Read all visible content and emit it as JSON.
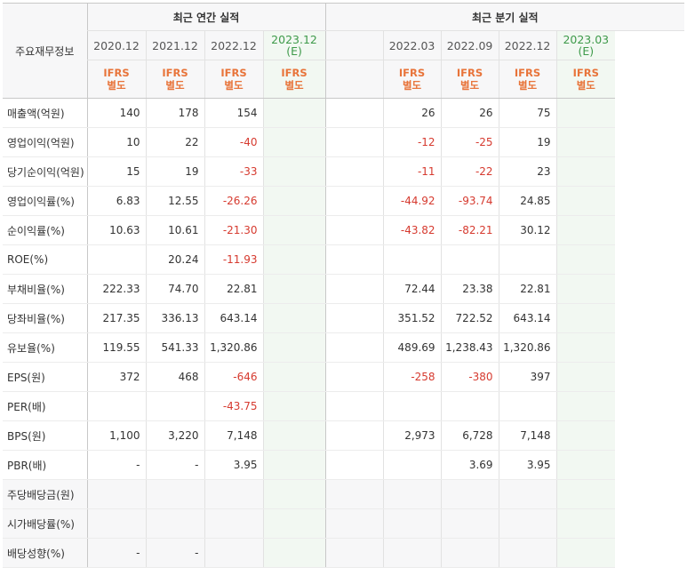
{
  "header": {
    "corner_label": "주요재무정보",
    "group_annual": "최근 연간 실적",
    "group_quarterly": "최근 분기 실적",
    "annual_columns": [
      {
        "period": "2020.12",
        "estimate": "",
        "basis_1": "IFRS",
        "basis_2": "별도"
      },
      {
        "period": "2021.12",
        "estimate": "",
        "basis_1": "IFRS",
        "basis_2": "별도"
      },
      {
        "period": "2022.12",
        "estimate": "",
        "basis_1": "IFRS",
        "basis_2": "별도"
      },
      {
        "period": "2023.12",
        "estimate": "(E)",
        "basis_1": "IFRS",
        "basis_2": "별도"
      }
    ],
    "quarter_columns": [
      {
        "period": "",
        "estimate": "",
        "basis_1": "",
        "basis_2": ""
      },
      {
        "period": "2022.03",
        "estimate": "",
        "basis_1": "IFRS",
        "basis_2": "별도"
      },
      {
        "period": "2022.09",
        "estimate": "",
        "basis_1": "IFRS",
        "basis_2": "별도"
      },
      {
        "period": "2022.12",
        "estimate": "",
        "basis_1": "IFRS",
        "basis_2": "별도"
      },
      {
        "period": "2023.03",
        "estimate": "(E)",
        "basis_1": "IFRS",
        "basis_2": "별도"
      }
    ]
  },
  "rows": [
    {
      "label": "매출액(억원)",
      "annual": [
        "140",
        "178",
        "154",
        ""
      ],
      "quarterly": [
        "",
        "",
        "26",
        "26",
        "75",
        ""
      ]
    },
    {
      "label": "영업이익(억원)",
      "annual": [
        "10",
        "22",
        "-40",
        ""
      ],
      "quarterly": [
        "",
        "",
        "-12",
        "-25",
        "19",
        ""
      ]
    },
    {
      "label": "당기순이익(억원)",
      "annual": [
        "15",
        "19",
        "-33",
        ""
      ],
      "quarterly": [
        "",
        "",
        "-11",
        "-22",
        "23",
        ""
      ]
    },
    {
      "label": "영업이익률(%)",
      "annual": [
        "6.83",
        "12.55",
        "-26.26",
        ""
      ],
      "quarterly": [
        "",
        "",
        "-44.92",
        "-93.74",
        "24.85",
        ""
      ]
    },
    {
      "label": "순이익률(%)",
      "annual": [
        "10.63",
        "10.61",
        "-21.30",
        ""
      ],
      "quarterly": [
        "",
        "",
        "-43.82",
        "-82.21",
        "30.12",
        ""
      ]
    },
    {
      "label": "ROE(%)",
      "annual": [
        "",
        "20.24",
        "-11.93",
        ""
      ],
      "quarterly": [
        "",
        "",
        "",
        "",
        "",
        ""
      ]
    },
    {
      "label": "부채비율(%)",
      "annual": [
        "222.33",
        "74.70",
        "22.81",
        ""
      ],
      "quarterly": [
        "",
        "",
        "72.44",
        "23.38",
        "22.81",
        ""
      ]
    },
    {
      "label": "당좌비율(%)",
      "annual": [
        "217.35",
        "336.13",
        "643.14",
        ""
      ],
      "quarterly": [
        "",
        "",
        "351.52",
        "722.52",
        "643.14",
        ""
      ]
    },
    {
      "label": "유보율(%)",
      "annual": [
        "119.55",
        "541.33",
        "1,320.86",
        ""
      ],
      "quarterly": [
        "",
        "",
        "489.69",
        "1,238.43",
        "1,320.86",
        ""
      ]
    },
    {
      "label": "EPS(원)",
      "annual": [
        "372",
        "468",
        "-646",
        ""
      ],
      "quarterly": [
        "",
        "",
        "-258",
        "-380",
        "397",
        ""
      ]
    },
    {
      "label": "PER(배)",
      "annual": [
        "",
        "",
        "-43.75",
        ""
      ],
      "quarterly": [
        "",
        "",
        "",
        "",
        "",
        ""
      ]
    },
    {
      "label": "BPS(원)",
      "annual": [
        "1,100",
        "3,220",
        "7,148",
        ""
      ],
      "quarterly": [
        "",
        "",
        "2,973",
        "6,728",
        "7,148",
        ""
      ]
    },
    {
      "label": "PBR(배)",
      "annual": [
        "-",
        "-",
        "3.95",
        ""
      ],
      "quarterly": [
        "",
        "",
        "",
        "3.69",
        "3.95",
        ""
      ]
    },
    {
      "label": "주당배당금(원)",
      "annual": [
        "",
        "",
        "",
        ""
      ],
      "quarterly": [
        "",
        "",
        "",
        "",
        "",
        ""
      ]
    },
    {
      "label": "시가배당률(%)",
      "annual": [
        "",
        "",
        "",
        ""
      ],
      "quarterly": [
        "",
        "",
        "",
        "",
        "",
        ""
      ]
    },
    {
      "label": "배당성향(%)",
      "annual": [
        "-",
        "-",
        "",
        ""
      ],
      "quarterly": [
        "",
        "",
        "",
        "",
        "",
        ""
      ]
    }
  ],
  "colors": {
    "negative": "#d63a2f",
    "basis_label": "#e8743a",
    "estimate_label": "#3e9a4a",
    "estimate_column_bg": "#f2f8f2",
    "header_bg": "#f7f7f8"
  }
}
